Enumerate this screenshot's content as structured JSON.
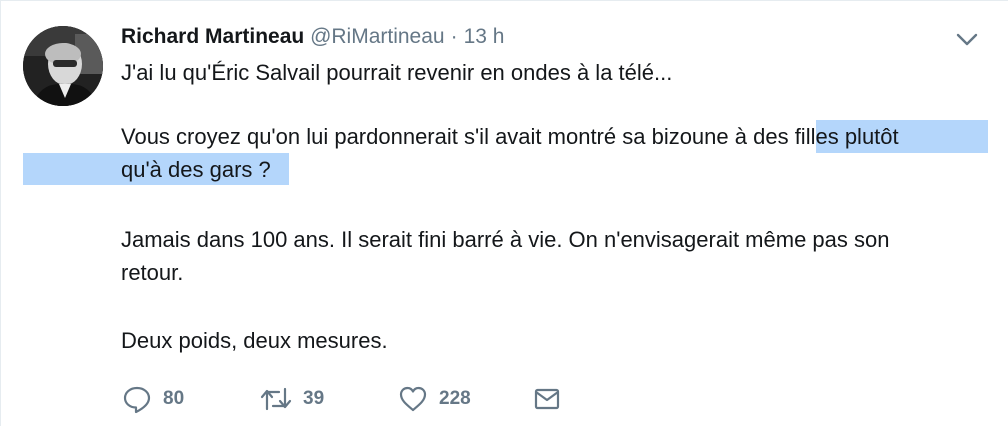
{
  "tweet": {
    "author_name": "Richard Martineau",
    "handle": "@RiMartineau",
    "separator": "·",
    "time": "13 h",
    "paragraphs": {
      "p1": "J'ai lu qu'Éric Salvail pourrait revenir en ondes à la télé...",
      "p2_line1_plain": "Vous croyez qu'on lui pardonnerait s'il avait montré sa bizoune à ",
      "p2_line1_selected": "des filles plutôt",
      "p2_line2_selected": "qu'à des gars ?",
      "p3_line1": "Jamais dans 100 ans. Il serait fini barré à vie. On n'envisagerait même pas son",
      "p3_line2": "retour.",
      "p4": "Deux poids, deux mesures."
    },
    "actions": {
      "reply_count": "80",
      "retweet_count": "39",
      "like_count": "228"
    }
  },
  "colors": {
    "text": "#14171a",
    "secondary": "#657786",
    "selection": "#b4d6fb",
    "border": "#e6ecf0"
  },
  "icons": {
    "menu": "chevron-down-icon",
    "reply": "reply-icon",
    "retweet": "retweet-icon",
    "like": "heart-icon",
    "dm": "envelope-icon"
  }
}
